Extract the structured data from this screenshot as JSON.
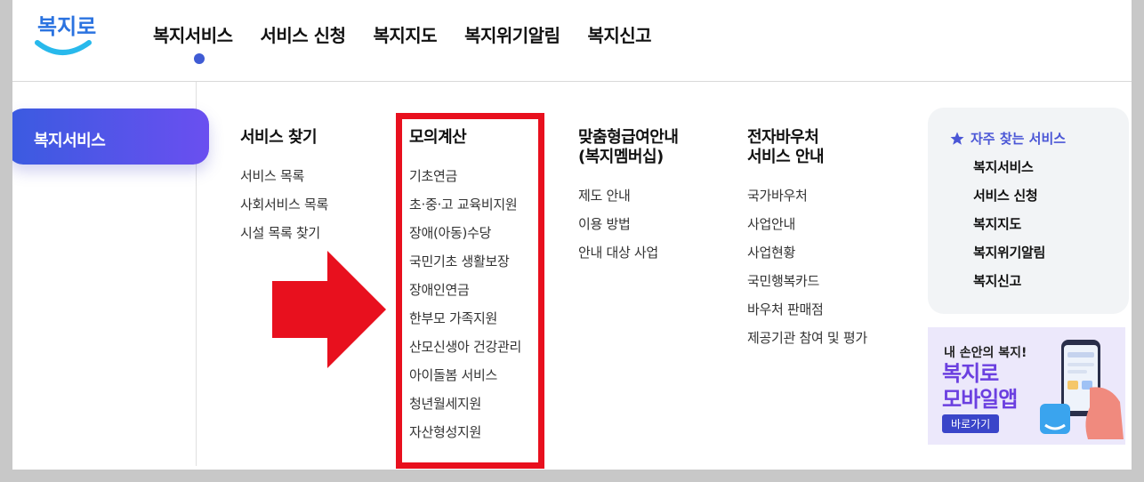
{
  "header": {
    "logo_text": "복지로",
    "nav": [
      "복지서비스",
      "서비스 신청",
      "복지지도",
      "복지위기알림",
      "복지신고"
    ],
    "active_index": 0
  },
  "sidebar": {
    "active_label": "복지서비스"
  },
  "columns": [
    {
      "title": "서비스 찾기",
      "items": [
        "서비스 목록",
        "사회서비스 목록",
        "시설 목록 찾기"
      ]
    },
    {
      "title": "모의계산",
      "items": [
        "기초연금",
        "초·중·고 교육비지원",
        "장애(아동)수당",
        "국민기초 생활보장",
        "장애인연금",
        "한부모 가족지원",
        "산모신생아 건강관리",
        "아이돌봄 서비스",
        "청년월세지원",
        "자산형성지원"
      ]
    },
    {
      "title_line1": "맞춤형급여안내",
      "title_line2": "(복지멤버십)",
      "items": [
        "제도 안내",
        "이용 방법",
        "안내 대상 사업"
      ]
    },
    {
      "title_line1": "전자바우처",
      "title_line2": "서비스 안내",
      "items": [
        "국가바우처",
        "사업안내",
        "사업현황",
        "국민행복카드",
        "바우처 판매점",
        "제공기관 참여 및 평가"
      ]
    }
  ],
  "favorites": {
    "title": "자주 찾는 서비스",
    "items": [
      "복지서비스",
      "서비스 신청",
      "복지지도",
      "복지위기알림",
      "복지신고"
    ]
  },
  "banner": {
    "line1": "내 손안의 복지!",
    "line2a": "복지로",
    "line2b": "모바일앱",
    "button": "바로가기"
  },
  "colors": {
    "accent": "#3f5bd4",
    "highlight": "#e8101e",
    "fav_title": "#4a56d6"
  }
}
